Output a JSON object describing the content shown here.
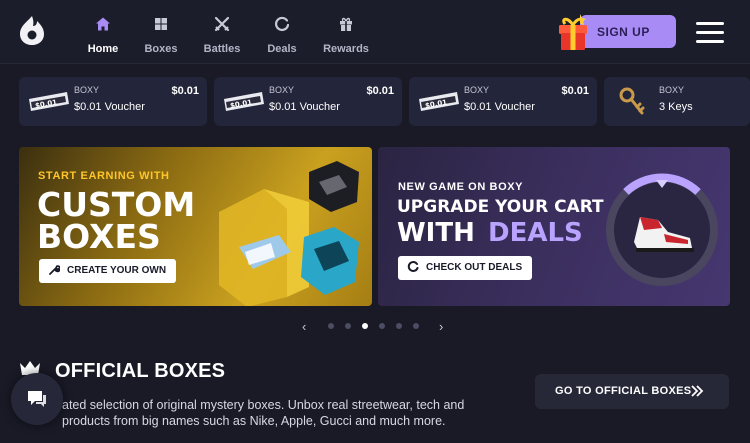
{
  "nav": {
    "items": [
      {
        "label": "Home",
        "icon": "home-icon",
        "active": true
      },
      {
        "label": "Boxes",
        "icon": "boxes-icon"
      },
      {
        "label": "Battles",
        "icon": "swords-icon"
      },
      {
        "label": "Deals",
        "icon": "deals-icon"
      },
      {
        "label": "Rewards",
        "icon": "gift-icon"
      }
    ],
    "signup_label": "SIGN UP"
  },
  "live_drops": [
    {
      "brand": "BOXY",
      "name": "$0.01 Voucher",
      "price": "$0.01",
      "thumb_text": "$0.01"
    },
    {
      "brand": "BOXY",
      "name": "$0.01 Voucher",
      "price": "$0.01",
      "thumb_text": "$0.01"
    },
    {
      "brand": "BOXY",
      "name": "$0.01 Voucher",
      "price": "$0.01",
      "thumb_text": "$0.01"
    },
    {
      "brand": "BOXY",
      "name": "3 Keys",
      "price": ""
    }
  ],
  "banners": {
    "custom": {
      "kicker": "START EARNING WITH",
      "line1": "CUSTOM",
      "line2": "BOXES",
      "button": "CREATE YOUR OWN"
    },
    "deals": {
      "kicker": "NEW GAME ON BOXY",
      "line1": "UPGRADE YOUR CART",
      "line2_a": "WITH",
      "line2_b": "DEALS",
      "button": "CHECK OUT DEALS"
    }
  },
  "carousel": {
    "prev": "‹",
    "next": "›",
    "dot_count": 6,
    "active_index": 2
  },
  "official": {
    "title": "OFFICIAL BOXES",
    "description": "ated selection of original mystery boxes. Unbox real streetwear, tech and products from big names such as Nike, Apple, Gucci and much more.",
    "desc_line1": "ated selection of original mystery boxes. Unbox real streetwear, tech and",
    "desc_line2": "products from big names such as Nike, Apple, Gucci and much more.",
    "button": "GO TO OFFICIAL BOXES"
  },
  "colors": {
    "accent": "#a98bf5",
    "deals_highlight": "#b9a3ff",
    "kicker_gold": "#ffc629",
    "background": "#191a26"
  }
}
